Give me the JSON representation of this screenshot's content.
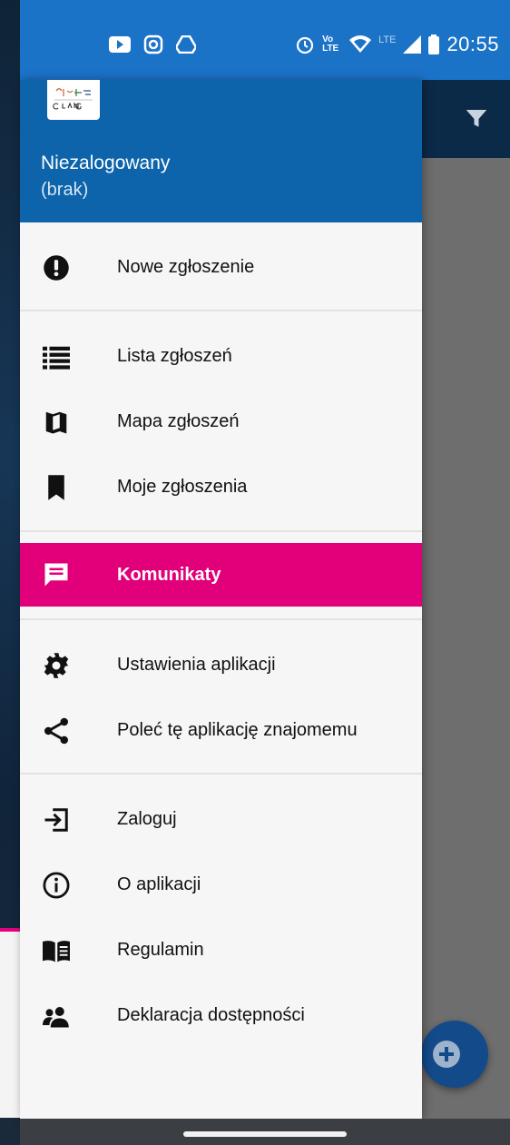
{
  "status_bar": {
    "time": "20:55",
    "left_icons": [
      "youtube-icon",
      "instagram-icon",
      "drive-icon"
    ],
    "right_icons": [
      "alarm-icon",
      "volte-icon",
      "wifi-icon",
      "lte-icon",
      "signal-icon",
      "battery-icon"
    ],
    "network_label": "LTE",
    "volte_label": "Vo LTE"
  },
  "drawer": {
    "user_name": "Niezalogowany",
    "user_sub": "(brak)",
    "accent_color": "#e2007a",
    "header_color": "#0d64aa",
    "items": [
      {
        "label": "Nowe zgłoszenie",
        "icon": "alert-circle-icon"
      },
      {
        "label": "Lista zgłoszeń",
        "icon": "list-icon"
      },
      {
        "label": "Mapa zgłoszeń",
        "icon": "map-icon"
      },
      {
        "label": "Moje zgłoszenia",
        "icon": "bookmark-icon"
      },
      {
        "label": "Komunikaty",
        "icon": "message-icon",
        "active": true
      },
      {
        "label": "Ustawienia aplikacji",
        "icon": "gear-icon"
      },
      {
        "label": "Poleć tę aplikację znajomemu",
        "icon": "share-icon"
      },
      {
        "label": "Zaloguj",
        "icon": "login-icon"
      },
      {
        "label": "O aplikacji",
        "icon": "info-icon"
      },
      {
        "label": "Regulamin",
        "icon": "book-icon"
      },
      {
        "label": "Deklaracja dostępności",
        "icon": "people-icon"
      }
    ]
  },
  "background_app": {
    "toolbar_icons": [
      "filter-icon"
    ],
    "fab_icon": "add-icon"
  }
}
